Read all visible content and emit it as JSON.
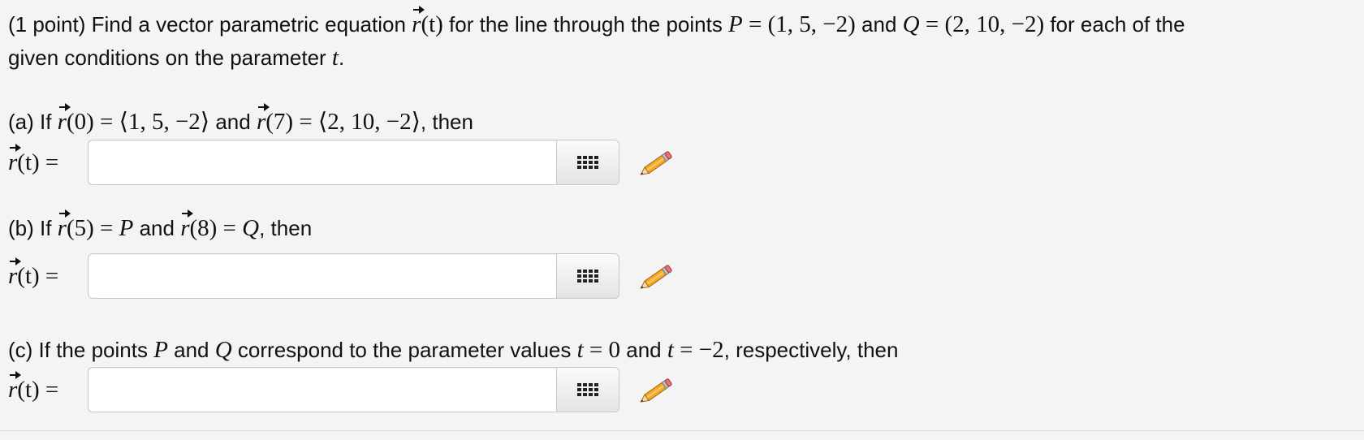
{
  "intro": {
    "prefix": "(1 point) Find a vector parametric equation ",
    "rt": "r",
    "rt_arg": "(t)",
    "mid1": " for the line through the points ",
    "P": "P",
    "eq": " = ",
    "P_coords": "(1, 5, −2)",
    "and": " and ",
    "Q": "Q",
    "Q_coords": "(2, 10, −2)",
    "suffix": " for each of the",
    "line2": "given conditions on the parameter ",
    "t": "t",
    "period": "."
  },
  "parts": [
    {
      "label": "(a) If ",
      "r0": "(0) = ⟨1, 5, −2⟩",
      "and": " and ",
      "r7": "(7) = ⟨2, 10, −2⟩",
      "then": ", then"
    },
    {
      "label": "(b) If ",
      "r5": "(5) = ",
      "P": "P",
      "and": " and ",
      "r8": "(8) = ",
      "Q": "Q",
      "then": ", then"
    },
    {
      "label": "(c) If the points ",
      "P": "P",
      "and1": " and ",
      "Q": "Q",
      "mid": " correspond to the parameter values ",
      "t1": "t",
      "eq0": " = 0",
      "and2": " and ",
      "t2": "t",
      "eqm2": " = −2",
      "then": ", respectively, then"
    }
  ],
  "answer_label": {
    "r": "r",
    "rest": "(t) = "
  },
  "answers": [
    {
      "value": ""
    },
    {
      "value": ""
    },
    {
      "value": ""
    }
  ],
  "icons": {
    "equation_editor": "grid-icon",
    "pencil": "pencil-icon"
  }
}
